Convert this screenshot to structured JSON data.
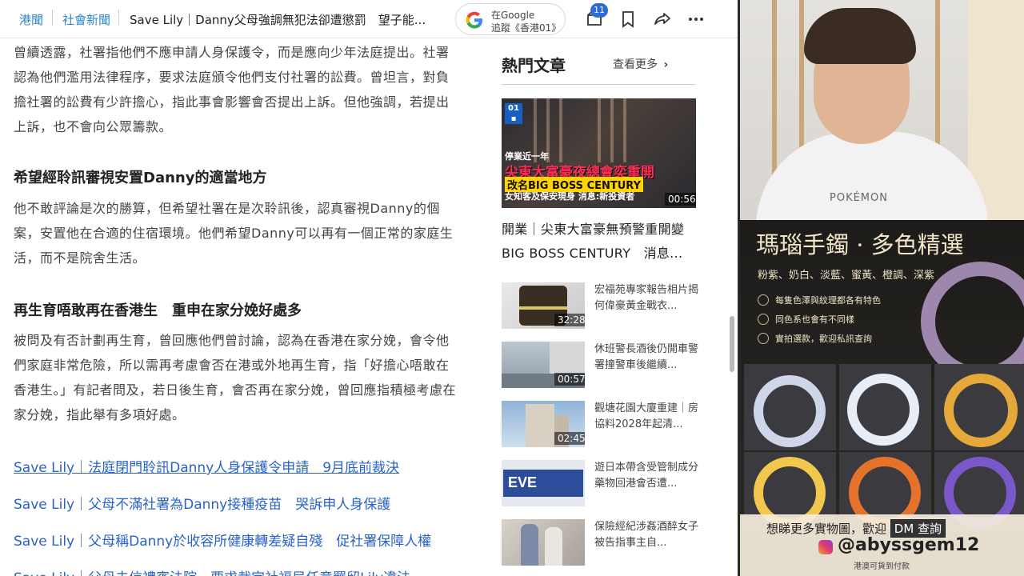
{
  "breadcrumb": {
    "item1": "港聞",
    "item2": "社會新聞"
  },
  "top_title": "Save Lily｜Danny父母強調無犯法卻遭懲罰　望子能...",
  "google_follow": {
    "line1": "在Google",
    "line2": "追蹤《香港01》"
  },
  "notifications_count": "11",
  "article": {
    "para1": "曾續透露，社署指他們不應申請人身保護令，而是應向少年法庭提出。社署認為他們濫用法律程序，要求法庭頒令他們支付社署的訟費。曾坦言，對負擔社署的訟費有少許擔心，指此事會影響會否提出上訴。但他強調，若提出上訴，也不會向公眾籌款。",
    "heading1": "希望經聆訊審視安置Danny的適當地方",
    "para2": "他不敢評論是次的勝算，但希望社署在是次聆訊後，認真審視Danny的個案，安置他在合適的住宿環境。他們希望Danny可以再有一個正常的家庭生活，而不是院舍生活。",
    "heading2": "再生育唔敢再在香港生　重申在家分娩好處多",
    "para3": "被問及有否計劃再生育，曾回應他們曾討論，認為在香港在家分娩，會令他們家庭非常危險，所以需再考慮會否在港或外地再生育，指「好擔心唔敢在香港生。」有記者問及，若日後生育，會否再在家分娩，曾回應指積極考慮在家分娩，指此舉有多項好處。",
    "related_links": [
      "Save Lily｜法庭閉門聆訊Danny人身保護令申請　9月底前裁決",
      "Save Lily｜父母不滿社署為Danny接種疫苗　哭訴申人身保護",
      "Save Lily｜父母稱Danny於收容所健康轉差疑自殘　促社署保障人權",
      "Save Lily｜父母去信禮賓法院　要求裁定社福局任意羈留Lily違法"
    ]
  },
  "sidebar": {
    "hot_title": "熱門文章",
    "see_more": "查看更多",
    "feature": {
      "caption1": "停業近一年",
      "caption2": "尖東大富豪夜總會奕重開",
      "caption3": "改名BIG BOSS CENTURY",
      "caption4": "女知客及保安現身  消息:新投資者",
      "duration": "00:56",
      "title": "開業｜尖東大富豪無預警重開變BIG BOSS CENTURY　消息..."
    },
    "items": [
      {
        "text": "宏福苑專家報告相片揭何偉豪黃金戰衣...",
        "duration": "32:28"
      },
      {
        "text": "休班警長酒後仍開車警署撞警車後繼續...",
        "duration": "00:57"
      },
      {
        "text": "觀塘花園大廈重建｜房協料2028年起清...",
        "duration": "02:45"
      },
      {
        "text": "遊日本帶含受管制成分藥物回港會否遭...",
        "duration": ""
      },
      {
        "text": "保險經紀涉姦酒醉女子　被告指事主自...",
        "duration": ""
      }
    ]
  },
  "webcam": {
    "shirt_text": "POKÉMON"
  },
  "ad": {
    "title": "瑪瑙手鐲 · 多色精選",
    "colors": "粉紫、奶白、淡藍、蜜黃、橙調、深紫",
    "features": [
      "每隻色澤與紋理都各有特色",
      "同色系也會有不同樣",
      "實拍選款，歡迎私訊查詢"
    ],
    "cta_prefix": "想睇更多實物圖，歡迎",
    "cta_box": "DM 查詢",
    "handle": "@abyssgem12",
    "footer": "港澳可貨到付款"
  },
  "colors": {
    "link": "#2a62c9",
    "breadcrumb": "#2e86c8",
    "badge": "#2e6bd6"
  }
}
